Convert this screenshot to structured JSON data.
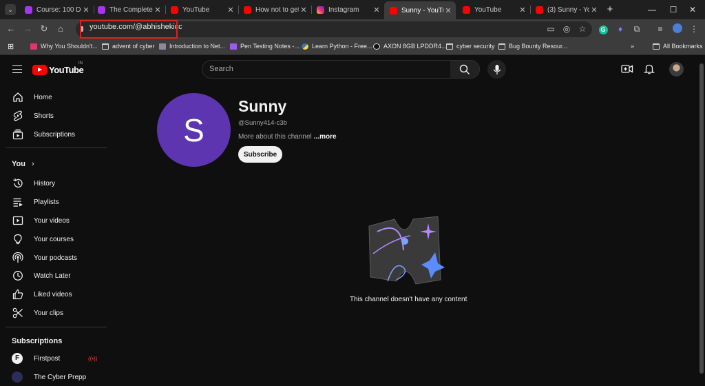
{
  "browser": {
    "tabs": [
      {
        "label": "Course: 100 Day",
        "icon": "udemy-icon"
      },
      {
        "label": "The Complete 2(",
        "icon": "udemy-icon"
      },
      {
        "label": "YouTube",
        "icon": "youtube-icon"
      },
      {
        "label": "How not to get c",
        "icon": "youtube-icon"
      },
      {
        "label": "Instagram",
        "icon": "instagram-icon"
      },
      {
        "label": "Sunny - YouTube",
        "icon": "youtube-icon",
        "active": true
      },
      {
        "label": "YouTube",
        "icon": "youtube-icon"
      },
      {
        "label": "(3) Sunny - YouT",
        "icon": "youtube-icon"
      }
    ],
    "url": "youtube.com/@abhishekicc",
    "bookmarks": [
      {
        "label": "Why You Shouldn't..."
      },
      {
        "label": "advent of cyber"
      },
      {
        "label": "Introduction to Net..."
      },
      {
        "label": "Pen Testing Notes -..."
      },
      {
        "label": "Learn Python - Free..."
      },
      {
        "label": "AXON 8GB LPDDR4..."
      },
      {
        "label": "cyber security"
      },
      {
        "label": "Bug Bounty Resour..."
      }
    ],
    "all_bookmarks": "All Bookmarks"
  },
  "youtube": {
    "logo": "YouTube",
    "region": "IN",
    "search_placeholder": "Search"
  },
  "sidebar": {
    "main": [
      {
        "label": "Home",
        "icon": "home-icon"
      },
      {
        "label": "Shorts",
        "icon": "shorts-icon"
      },
      {
        "label": "Subscriptions",
        "icon": "subscriptions-icon"
      }
    ],
    "you_heading": "You",
    "you": [
      {
        "label": "History",
        "icon": "history-icon"
      },
      {
        "label": "Playlists",
        "icon": "playlists-icon"
      },
      {
        "label": "Your videos",
        "icon": "your-videos-icon"
      },
      {
        "label": "Your courses",
        "icon": "courses-icon"
      },
      {
        "label": "Your podcasts",
        "icon": "podcasts-icon"
      },
      {
        "label": "Watch Later",
        "icon": "watch-later-icon"
      },
      {
        "label": "Liked videos",
        "icon": "liked-icon"
      },
      {
        "label": "Your clips",
        "icon": "clips-icon"
      }
    ],
    "subscriptions_heading": "Subscriptions",
    "subscriptions": [
      {
        "label": "Firstpost",
        "avatar": "F",
        "live": true
      },
      {
        "label": "The Cyber Prepp"
      }
    ]
  },
  "channel": {
    "avatar_letter": "S",
    "avatar_color": "#5e35b1",
    "name": "Sunny",
    "handle": "@Sunny414-c3b",
    "about": "More about this channel",
    "more": "...more",
    "subscribe": "Subscribe",
    "empty_message": "This channel doesn't have any content"
  }
}
